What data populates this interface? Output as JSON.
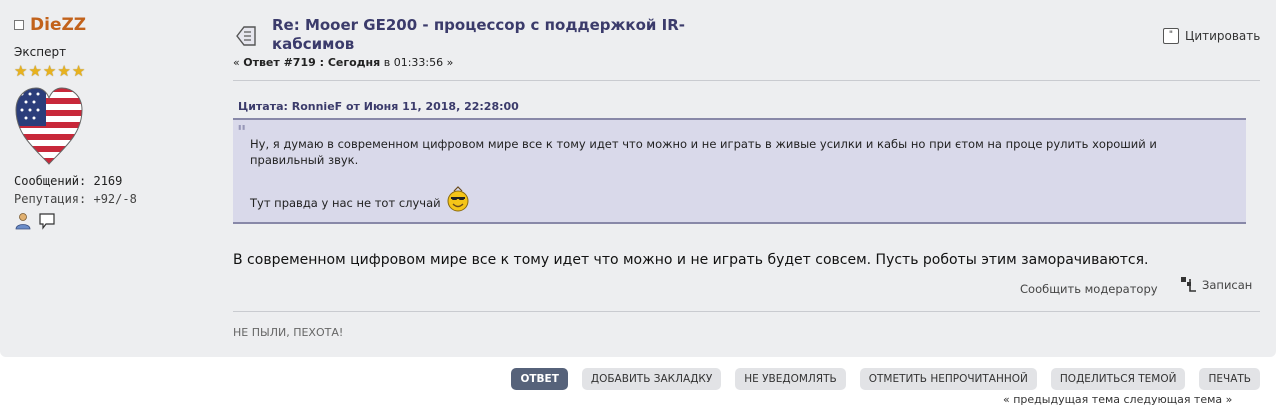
{
  "poster": {
    "name": "DieZZ",
    "rank": "Эксперт",
    "stars": 5,
    "posts_label": "Сообщений: 2169",
    "reputation_label": "Репутация: +92/-8"
  },
  "post": {
    "subject": "Re: Mooer GE200 - процессор с поддержкой IR-кабсимов",
    "info_prefix": "« ",
    "info_reply": "Ответ #719 : Сегодня",
    "info_time": " в 01:33:56 »",
    "quote_button": "Цитировать",
    "quote_header": "Цитата: RonnieF от Июня 11, 2018, 22:28:00",
    "quote_text_1": "Ну, я думаю в современном цифровом мире все к тому идет что можно и не играть в живые усилки и кабы но при єтом на проце рулить хороший и правильный звук.",
    "quote_text_2": "Тут правда у нас не тот случай",
    "message": "В современном цифровом мире все к тому идет что можно и не играть будет совсем. Пусть роботы этим заморачиваются.",
    "report_link": "Сообщить модератору",
    "logged": "Записан",
    "signature": "НЕ ПЫЛИ, ПЕХОТА!"
  },
  "actions": {
    "reply": "ОТВЕТ",
    "bookmark": "ДОБАВИТЬ ЗАКЛАДКУ",
    "no_notify": "НЕ УВЕДОМЛЯТЬ",
    "mark_unread": "ОТМЕТИТЬ НЕПРОЧИТАННОЙ",
    "share": "ПОДЕЛИТЬСЯ ТЕМОЙ",
    "print": "ПЕЧАТЬ"
  },
  "nav_links": "« предыдущая тема следующая тема »",
  "colors": {
    "accent": "#c2621b",
    "subject": "#3b3b6b",
    "quote_bg": "#d9d9ea",
    "primary_button": "#56627a"
  }
}
